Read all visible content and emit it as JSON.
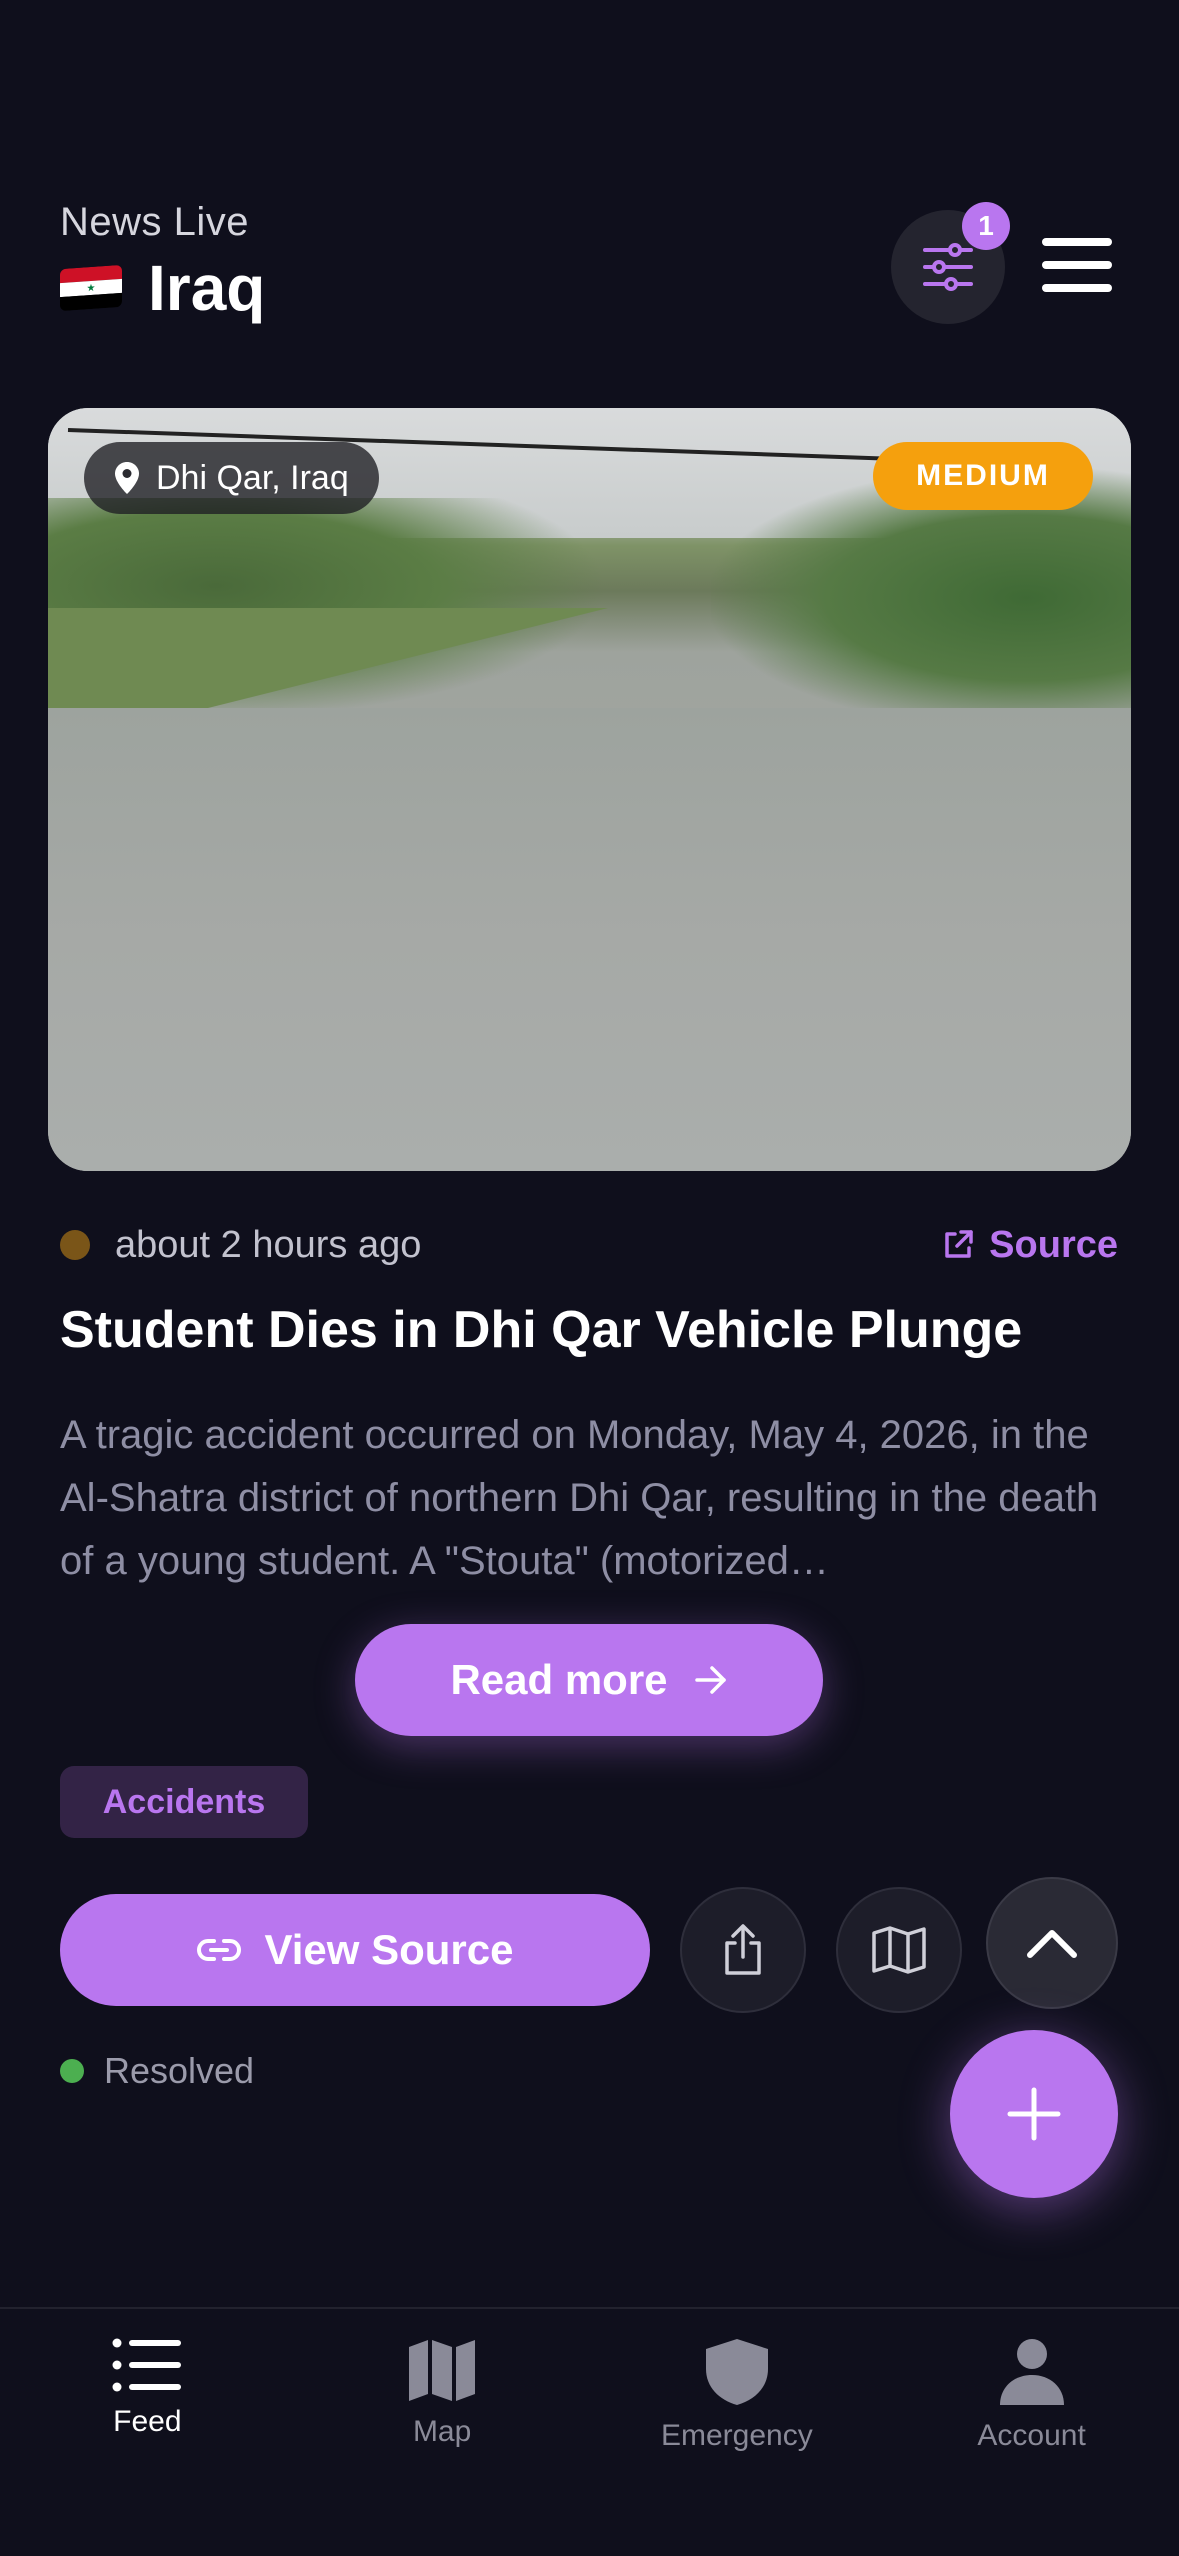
{
  "header": {
    "subtitle": "News Live",
    "country": "Iraq",
    "country_flag": "iraq-flag",
    "filter_badge_count": "1"
  },
  "article": {
    "location": "Dhi Qar, Iraq",
    "severity": "MEDIUM",
    "time_ago": "about 2 hours ago",
    "source_label": "Source",
    "headline": "Student Dies in Dhi Qar Vehicle Plunge",
    "summary": "A tragic accident occurred on Monday, May 4, 2026, in the Al-Shatra district of northern Dhi Qar, resulting in the death of a young student. A \"Stouta\" (motorized…",
    "read_more_label": "Read more",
    "tag": "Accidents",
    "view_source_label": "View Source",
    "status": "Resolved"
  },
  "colors": {
    "accent": "#b976ef",
    "severity_medium": "#f5a00d",
    "status_resolved": "#4caf50",
    "background": "#0f0f1c"
  },
  "nav": {
    "items": [
      {
        "label": "Feed",
        "icon": "list-icon",
        "active": true
      },
      {
        "label": "Map",
        "icon": "map-icon",
        "active": false
      },
      {
        "label": "Emergency",
        "icon": "shield-icon",
        "active": false
      },
      {
        "label": "Account",
        "icon": "user-icon",
        "active": false
      }
    ]
  }
}
